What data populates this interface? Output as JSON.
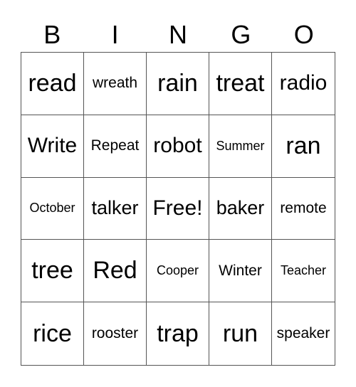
{
  "header": [
    "B",
    "I",
    "N",
    "G",
    "O"
  ],
  "cells": [
    [
      "read",
      "wreath",
      "rain",
      "treat",
      "radio"
    ],
    [
      "Write",
      "Repeat",
      "robot",
      "Summer",
      "ran"
    ],
    [
      "October",
      "talker",
      "Free!",
      "baker",
      "remote"
    ],
    [
      "tree",
      "Red",
      "Cooper",
      "Winter",
      "Teacher"
    ],
    [
      "rice",
      "rooster",
      "trap",
      "run",
      "speaker"
    ]
  ]
}
